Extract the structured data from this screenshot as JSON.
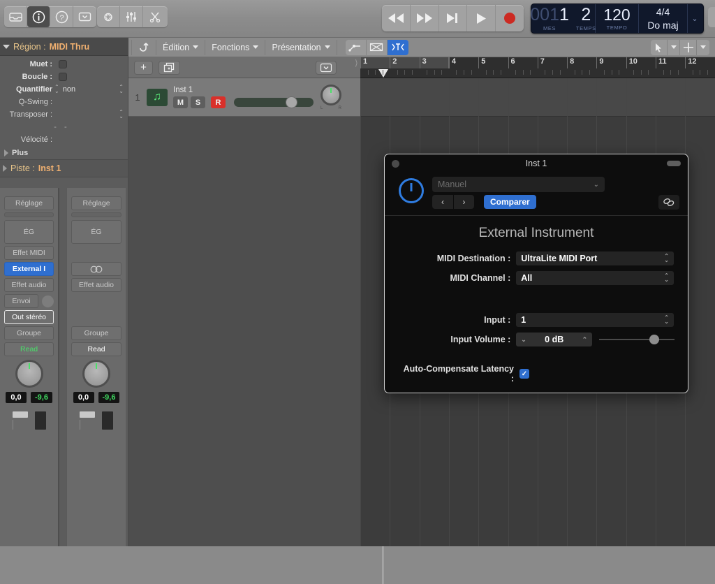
{
  "toolbar": {
    "left_icons": [
      {
        "name": "library-icon",
        "label": "Bibliothèque"
      },
      {
        "name": "info-icon",
        "label": "Inspecteur"
      },
      {
        "name": "help-icon",
        "label": "Aide rapide"
      },
      {
        "name": "toolbar-collapse-icon",
        "label": "Barre d'outils"
      }
    ],
    "second_icons": [
      {
        "name": "smart-controls-icon",
        "label": "Commandes intelligentes"
      },
      {
        "name": "mixer-icon",
        "label": "Table de mixage"
      },
      {
        "name": "editor-scissors-icon",
        "label": "Éditeurs"
      }
    ],
    "transport": [
      {
        "name": "rewind-button",
        "label": "Retour rapide"
      },
      {
        "name": "forward-button",
        "label": "Avance rapide"
      },
      {
        "name": "goto-end-button",
        "label": "Aller à la fin"
      },
      {
        "name": "play-button",
        "label": "Lecture"
      },
      {
        "name": "record-button",
        "label": "Enregistrer"
      }
    ],
    "record_color": "#d9302a"
  },
  "lcd": {
    "position_dim": "001",
    "position_bar": "1",
    "position_beat": "2",
    "label_bar": "MES",
    "label_beat": "TEMPS",
    "tempo_value": "120",
    "tempo_label": "TEMPO",
    "signature": "4/4",
    "key": "Do maj",
    "chevron": "⌄"
  },
  "inspector": {
    "region_prefix": "Région :",
    "region_name": "MIDI Thru",
    "rows": [
      {
        "label": "Muet :",
        "value": "",
        "type": "checkbox",
        "bold": true
      },
      {
        "label": "Boucle :",
        "value": "",
        "type": "checkbox",
        "bold": true
      },
      {
        "label": "Quantifier",
        "value": "non",
        "type": "stepper-value",
        "bold": true
      },
      {
        "label": "Q-Swing :",
        "value": "",
        "type": "text",
        "bold": false
      },
      {
        "label": "Transposer :",
        "value": "",
        "type": "stepper",
        "bold": false
      },
      {
        "label": "Vélocité :",
        "value": "",
        "type": "text",
        "bold": false
      }
    ],
    "dashes": "- -",
    "more_label": "Plus",
    "track_prefix": "Piste :",
    "track_name": "Inst 1"
  },
  "strips": [
    {
      "name": "channel-strip-inst1",
      "setting": "Réglage",
      "eq": "ÉG",
      "slots": [
        {
          "label": "Effet MIDI",
          "style": "plain"
        },
        {
          "label": "External I",
          "style": "blue"
        },
        {
          "label": "Effet audio",
          "style": "plain"
        },
        {
          "label": "Envoi",
          "style": "send"
        },
        {
          "label": "Out stéréo",
          "style": "outline"
        },
        {
          "label": "Groupe",
          "style": "plain"
        },
        {
          "label": "Read",
          "style": "green"
        }
      ],
      "pan_value": "0,0",
      "vol_value": "-9,6"
    },
    {
      "name": "channel-strip-output",
      "setting": "Réglage",
      "eq": "ÉG",
      "slots": [
        {
          "label": "",
          "style": "hidden"
        },
        {
          "label": "◎",
          "style": "stereo-icon"
        },
        {
          "label": "Effet audio",
          "style": "plain"
        },
        {
          "label": "",
          "style": "hidden"
        },
        {
          "label": "",
          "style": "hidden"
        },
        {
          "label": "Groupe",
          "style": "plain"
        },
        {
          "label": "Read",
          "style": "whiteread"
        }
      ],
      "pan_value": "0,0",
      "vol_value": "-9,6"
    }
  ],
  "menubar": {
    "items": [
      {
        "name": "tab-edition",
        "label": "Édition"
      },
      {
        "name": "tab-fonctions",
        "label": "Fonctions"
      },
      {
        "name": "tab-presentation",
        "label": "Présentation"
      }
    ],
    "undo_icon": "undo-arrow-icon",
    "mode_icons": [
      {
        "name": "automation-icon",
        "selected": false
      },
      {
        "name": "flex-fade-icon",
        "selected": false
      },
      {
        "name": "snap-marquee-icon",
        "selected": true
      }
    ],
    "right_tools": [
      {
        "name": "pointer-tool-icon"
      },
      {
        "name": "pointer-tool-chevron-icon"
      },
      {
        "name": "marquee-tool-icon"
      },
      {
        "name": "marquee-tool-chevron-icon"
      }
    ],
    "accent_blue": "#2f6fd0"
  },
  "track_controls": {
    "add_track_label": "+",
    "duplicate_track_label": "⧉",
    "collapse_label": "⌄"
  },
  "ruler": {
    "ticks": [
      "1",
      "2",
      "3",
      "4",
      "5",
      "6",
      "7",
      "8",
      "9",
      "10",
      "11",
      "12"
    ],
    "playhead_position": "1"
  },
  "track": {
    "number": "1",
    "name": "Inst 1",
    "icon": "midi-note-icon",
    "mute_label": "M",
    "solo_label": "S",
    "record_label": "R",
    "pan_left": "L",
    "pan_right": "R"
  },
  "plugin": {
    "window_title": "Inst 1",
    "preset_name": "Manuel",
    "prev_label": "‹",
    "next_label": "›",
    "compare_label": "Comparer",
    "link_icon": "link-chain-icon",
    "power_icon": "power-button-icon",
    "plugin_name": "External Instrument",
    "params": [
      {
        "label": "MIDI Destination :",
        "value": "UltraLite MIDI Port",
        "type": "popup"
      },
      {
        "label": "MIDI Channel :",
        "value": "All",
        "type": "popup"
      },
      {
        "label": "Input :",
        "value": "1",
        "type": "popup"
      },
      {
        "label": "Input Volume :",
        "value": "0 dB",
        "type": "stepper-slider"
      }
    ],
    "auto_compensate_label": "Auto-Compensate Latency :",
    "auto_compensate_checked": "✓"
  }
}
